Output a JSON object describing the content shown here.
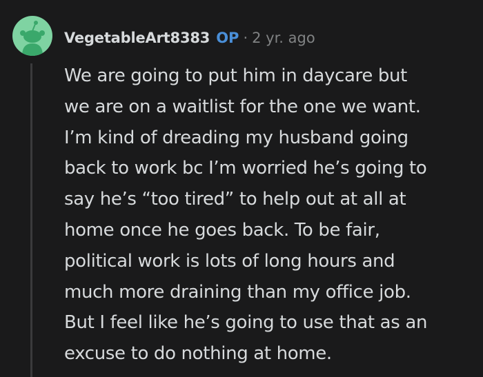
{
  "comment": {
    "author": "VegetableArt8383",
    "badge": "OP",
    "separator": "·",
    "timestamp": "2 yr. ago",
    "avatar_icon": "snoo-avatar-icon",
    "avatar_color": "#7fd3a2",
    "body_lines": [
      "We are going to put him in daycare but",
      "we are on a waitlist for the one we want.",
      "I’m kind of dreading my husband going",
      "back to work bc I’m worried he’s going to",
      "say he’s “too tired” to help out at all at",
      "home once he goes back. To be fair,",
      "political work is lots of long hours and",
      "much more draining than my office job.",
      "But I feel like he’s going to use that as an",
      "excuse to do nothing at home."
    ]
  },
  "colors": {
    "background": "#1a1a1b",
    "text": "#d7dadc",
    "op_badge": "#4a8fd8",
    "meta": "#818384",
    "thread_line": "#3a3a3c"
  }
}
